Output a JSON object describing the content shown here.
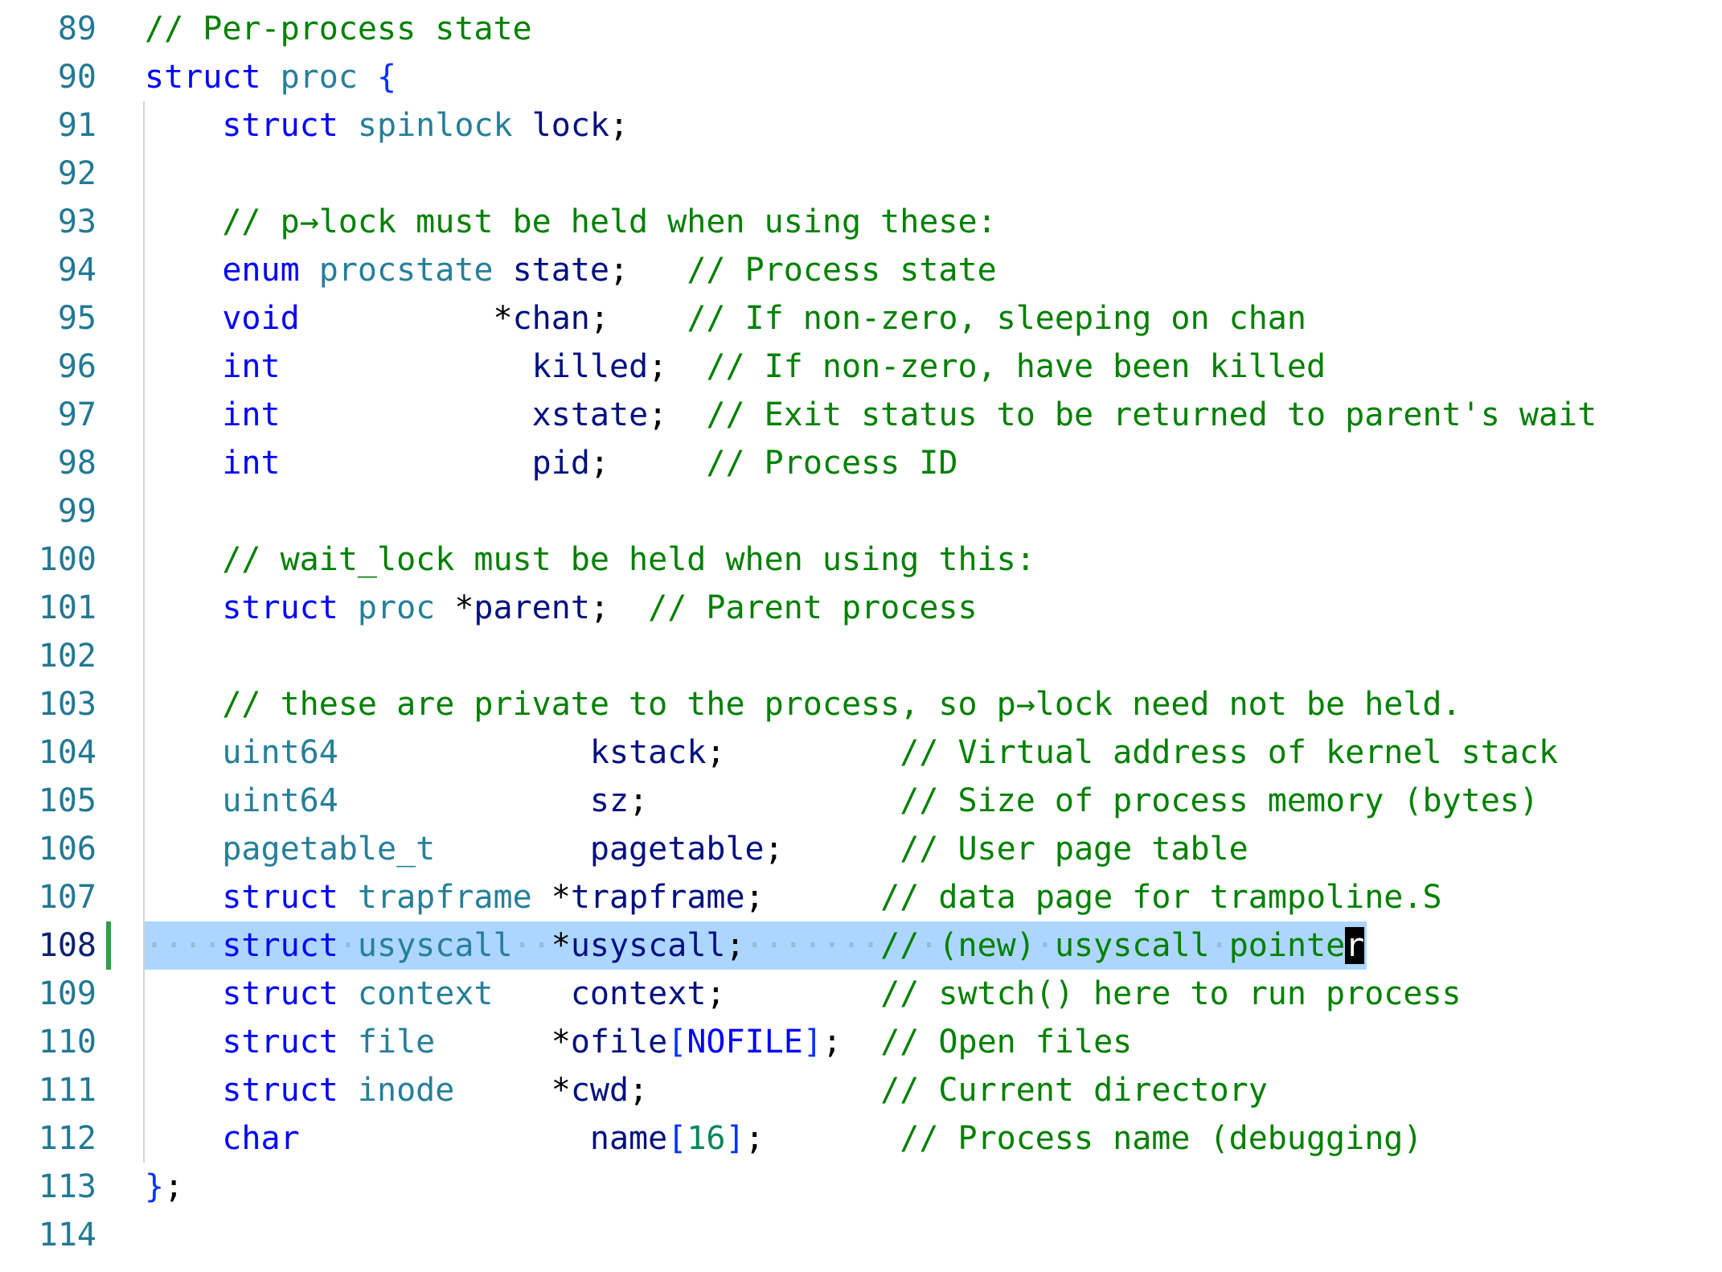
{
  "editor": {
    "first_line_number": 89,
    "current_line": 108,
    "line_numbers": [
      "89",
      "90",
      "91",
      "92",
      "93",
      "94",
      "95",
      "96",
      "97",
      "98",
      "99",
      "100",
      "101",
      "102",
      "103",
      "104",
      "105",
      "106",
      "107",
      "108",
      "109",
      "110",
      "111",
      "112",
      "113",
      "114"
    ],
    "lines": [
      [
        {
          "t": "// Per-process state",
          "c": "cm"
        }
      ],
      [
        {
          "t": "struct",
          "c": "kw"
        },
        {
          "t": " ",
          "c": "pn"
        },
        {
          "t": "proc",
          "c": "ty"
        },
        {
          "t": " ",
          "c": "pn"
        },
        {
          "t": "{",
          "c": "br"
        }
      ],
      [
        {
          "t": "    ",
          "c": "pn"
        },
        {
          "t": "struct",
          "c": "kw"
        },
        {
          "t": " ",
          "c": "pn"
        },
        {
          "t": "spinlock",
          "c": "ty"
        },
        {
          "t": " ",
          "c": "pn"
        },
        {
          "t": "lock",
          "c": "id"
        },
        {
          "t": ";",
          "c": "pn"
        }
      ],
      [],
      [
        {
          "t": "    ",
          "c": "pn"
        },
        {
          "t": "// p→lock must be held when using these:",
          "c": "cm"
        }
      ],
      [
        {
          "t": "    ",
          "c": "pn"
        },
        {
          "t": "enum",
          "c": "kw"
        },
        {
          "t": " ",
          "c": "pn"
        },
        {
          "t": "procstate",
          "c": "ty"
        },
        {
          "t": " ",
          "c": "pn"
        },
        {
          "t": "state",
          "c": "id"
        },
        {
          "t": ";   ",
          "c": "pn"
        },
        {
          "t": "// Process state",
          "c": "cm"
        }
      ],
      [
        {
          "t": "    ",
          "c": "pn"
        },
        {
          "t": "void",
          "c": "kw"
        },
        {
          "t": "          *",
          "c": "pn"
        },
        {
          "t": "chan",
          "c": "id"
        },
        {
          "t": ";    ",
          "c": "pn"
        },
        {
          "t": "// If non-zero, sleeping on chan",
          "c": "cm"
        }
      ],
      [
        {
          "t": "    ",
          "c": "pn"
        },
        {
          "t": "int",
          "c": "kw"
        },
        {
          "t": "             ",
          "c": "pn"
        },
        {
          "t": "killed",
          "c": "id"
        },
        {
          "t": ";  ",
          "c": "pn"
        },
        {
          "t": "// If non-zero, have been killed",
          "c": "cm"
        }
      ],
      [
        {
          "t": "    ",
          "c": "pn"
        },
        {
          "t": "int",
          "c": "kw"
        },
        {
          "t": "             ",
          "c": "pn"
        },
        {
          "t": "xstate",
          "c": "id"
        },
        {
          "t": ";  ",
          "c": "pn"
        },
        {
          "t": "// Exit status to be returned to parent's wait",
          "c": "cm"
        }
      ],
      [
        {
          "t": "    ",
          "c": "pn"
        },
        {
          "t": "int",
          "c": "kw"
        },
        {
          "t": "             ",
          "c": "pn"
        },
        {
          "t": "pid",
          "c": "id"
        },
        {
          "t": ";     ",
          "c": "pn"
        },
        {
          "t": "// Process ID",
          "c": "cm"
        }
      ],
      [],
      [
        {
          "t": "    ",
          "c": "pn"
        },
        {
          "t": "// wait_lock must be held when using this:",
          "c": "cm"
        }
      ],
      [
        {
          "t": "    ",
          "c": "pn"
        },
        {
          "t": "struct",
          "c": "kw"
        },
        {
          "t": " ",
          "c": "pn"
        },
        {
          "t": "proc",
          "c": "ty"
        },
        {
          "t": " *",
          "c": "pn"
        },
        {
          "t": "parent",
          "c": "id"
        },
        {
          "t": ";  ",
          "c": "pn"
        },
        {
          "t": "// Parent process",
          "c": "cm"
        }
      ],
      [],
      [
        {
          "t": "    ",
          "c": "pn"
        },
        {
          "t": "// these are private to the process, so p→lock need not be held.",
          "c": "cm"
        }
      ],
      [
        {
          "t": "    ",
          "c": "pn"
        },
        {
          "t": "uint64",
          "c": "ty"
        },
        {
          "t": "             ",
          "c": "pn"
        },
        {
          "t": "kstack",
          "c": "id"
        },
        {
          "t": ";         ",
          "c": "pn"
        },
        {
          "t": "// Virtual address of kernel stack",
          "c": "cm"
        }
      ],
      [
        {
          "t": "    ",
          "c": "pn"
        },
        {
          "t": "uint64",
          "c": "ty"
        },
        {
          "t": "             ",
          "c": "pn"
        },
        {
          "t": "sz",
          "c": "id"
        },
        {
          "t": ";             ",
          "c": "pn"
        },
        {
          "t": "// Size of process memory (bytes)",
          "c": "cm"
        }
      ],
      [
        {
          "t": "    ",
          "c": "pn"
        },
        {
          "t": "pagetable_t",
          "c": "ty"
        },
        {
          "t": "        ",
          "c": "pn"
        },
        {
          "t": "pagetable",
          "c": "id"
        },
        {
          "t": ";      ",
          "c": "pn"
        },
        {
          "t": "// User page table",
          "c": "cm"
        }
      ],
      [
        {
          "t": "    ",
          "c": "pn"
        },
        {
          "t": "struct",
          "c": "kw"
        },
        {
          "t": " ",
          "c": "pn"
        },
        {
          "t": "trapframe",
          "c": "ty"
        },
        {
          "t": " *",
          "c": "pn"
        },
        {
          "t": "trapframe",
          "c": "id"
        },
        {
          "t": ";      ",
          "c": "pn"
        },
        {
          "t": "// data page for trampoline.S",
          "c": "cm"
        }
      ],
      [
        {
          "t": "····",
          "c": "ws"
        },
        {
          "t": "struct",
          "c": "kw"
        },
        {
          "t": "·",
          "c": "ws"
        },
        {
          "t": "usyscall",
          "c": "ty"
        },
        {
          "t": "··",
          "c": "ws"
        },
        {
          "t": "*",
          "c": "pn"
        },
        {
          "t": "usyscall",
          "c": "id"
        },
        {
          "t": ";",
          "c": "pn"
        },
        {
          "t": "·······",
          "c": "ws"
        },
        {
          "t": "//",
          "c": "cm"
        },
        {
          "t": "·",
          "c": "ws"
        },
        {
          "t": "(new)",
          "c": "cm"
        },
        {
          "t": "·",
          "c": "ws"
        },
        {
          "t": "usyscall",
          "c": "cm"
        },
        {
          "t": "·",
          "c": "ws"
        },
        {
          "t": "pointe",
          "c": "cm"
        },
        {
          "t": "r",
          "c": "cursor-char"
        }
      ],
      [
        {
          "t": "    ",
          "c": "pn"
        },
        {
          "t": "struct",
          "c": "kw"
        },
        {
          "t": " ",
          "c": "pn"
        },
        {
          "t": "context",
          "c": "ty"
        },
        {
          "t": "    ",
          "c": "pn"
        },
        {
          "t": "context",
          "c": "id"
        },
        {
          "t": ";        ",
          "c": "pn"
        },
        {
          "t": "// swtch() here to run process",
          "c": "cm"
        }
      ],
      [
        {
          "t": "    ",
          "c": "pn"
        },
        {
          "t": "struct",
          "c": "kw"
        },
        {
          "t": " ",
          "c": "pn"
        },
        {
          "t": "file",
          "c": "ty"
        },
        {
          "t": "      *",
          "c": "pn"
        },
        {
          "t": "ofile",
          "c": "id"
        },
        {
          "t": "[",
          "c": "br"
        },
        {
          "t": "NOFILE",
          "c": "kw"
        },
        {
          "t": "]",
          "c": "br"
        },
        {
          "t": ";  ",
          "c": "pn"
        },
        {
          "t": "// Open files",
          "c": "cm"
        }
      ],
      [
        {
          "t": "    ",
          "c": "pn"
        },
        {
          "t": "struct",
          "c": "kw"
        },
        {
          "t": " ",
          "c": "pn"
        },
        {
          "t": "inode",
          "c": "ty"
        },
        {
          "t": "     *",
          "c": "pn"
        },
        {
          "t": "cwd",
          "c": "id"
        },
        {
          "t": ";            ",
          "c": "pn"
        },
        {
          "t": "// Current directory",
          "c": "cm"
        }
      ],
      [
        {
          "t": "    ",
          "c": "pn"
        },
        {
          "t": "char",
          "c": "kw"
        },
        {
          "t": "               ",
          "c": "pn"
        },
        {
          "t": "name",
          "c": "id"
        },
        {
          "t": "[",
          "c": "br"
        },
        {
          "t": "16",
          "c": "nm"
        },
        {
          "t": "]",
          "c": "br"
        },
        {
          "t": ";       ",
          "c": "pn"
        },
        {
          "t": "// Process name (debugging)",
          "c": "cm"
        }
      ],
      [
        {
          "t": "}",
          "c": "br"
        },
        {
          "t": ";",
          "c": "pn"
        }
      ],
      []
    ]
  }
}
